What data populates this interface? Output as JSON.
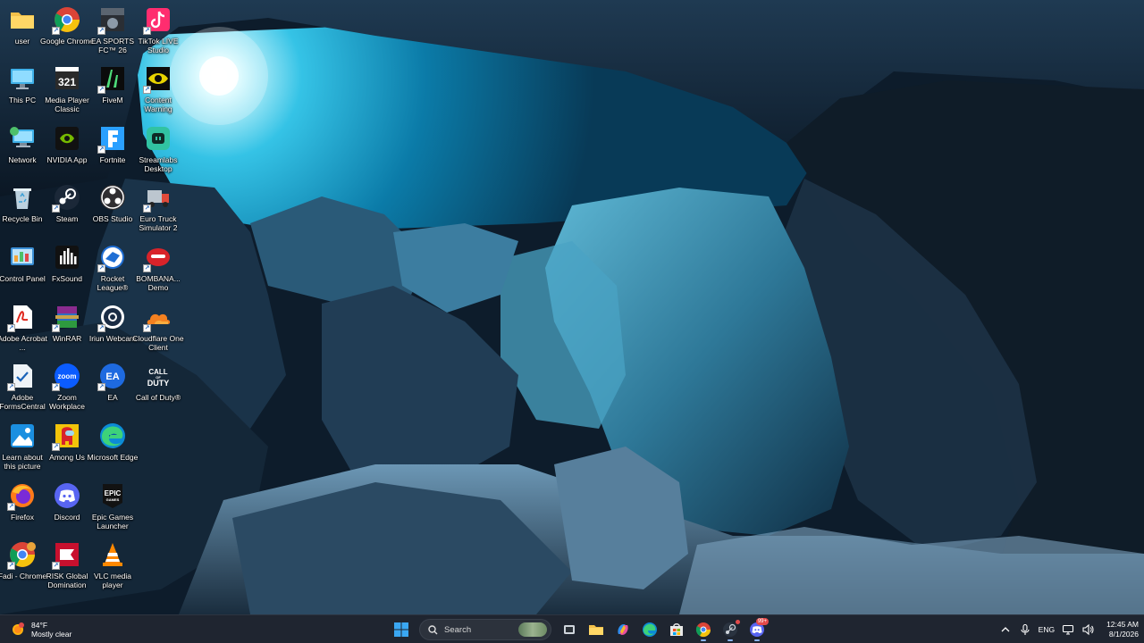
{
  "desktop": {
    "icons": [
      {
        "label": "user",
        "icon": "folder-icon"
      },
      {
        "label": "Google Chrome",
        "icon": "chrome-icon"
      },
      {
        "label": "EA SPORTS FC™ 26",
        "icon": "ea-fc-icon"
      },
      {
        "label": "TikTok LIVE Studio",
        "icon": "tiktok-icon"
      },
      {
        "label": "This PC",
        "icon": "monitor-icon"
      },
      {
        "label": "Media Player Classic",
        "icon": "media-player-icon"
      },
      {
        "label": "FiveM",
        "icon": "fivem-icon"
      },
      {
        "label": "Content Warning",
        "icon": "content-warning-icon"
      },
      {
        "label": "Network",
        "icon": "network-icon"
      },
      {
        "label": "NVIDIA App",
        "icon": "nvidia-icon"
      },
      {
        "label": "Fortnite",
        "icon": "fortnite-icon"
      },
      {
        "label": "Streamlabs Desktop",
        "icon": "streamlabs-icon"
      },
      {
        "label": "Recycle Bin",
        "icon": "recycle-bin-icon"
      },
      {
        "label": "Steam",
        "icon": "steam-icon"
      },
      {
        "label": "OBS Studio",
        "icon": "obs-icon"
      },
      {
        "label": "Euro Truck Simulator 2",
        "icon": "truck-icon"
      },
      {
        "label": "Control Panel",
        "icon": "control-panel-icon"
      },
      {
        "label": "FxSound",
        "icon": "fxsound-icon"
      },
      {
        "label": "Rocket League®",
        "icon": "rocket-league-icon"
      },
      {
        "label": "BOMBANA... Demo",
        "icon": "bombana-icon"
      },
      {
        "label": "Adobe Acrobat ...",
        "icon": "acrobat-icon"
      },
      {
        "label": "WinRAR",
        "icon": "winrar-icon"
      },
      {
        "label": "Iriun Webcam",
        "icon": "webcam-icon"
      },
      {
        "label": "Cloudflare One Client",
        "icon": "cloudflare-icon"
      },
      {
        "label": "Adobe FormsCentral",
        "icon": "formscentral-icon"
      },
      {
        "label": "Zoom Workplace",
        "icon": "zoom-icon"
      },
      {
        "label": "EA",
        "icon": "ea-icon"
      },
      {
        "label": "Call of Duty®",
        "icon": "call-of-duty-icon"
      },
      {
        "label": "Learn about this picture",
        "icon": "learn-picture-icon"
      },
      {
        "label": "Among Us",
        "icon": "among-us-icon"
      },
      {
        "label": "Microsoft Edge",
        "icon": "edge-icon"
      },
      {
        "label": "Firefox",
        "icon": "firefox-icon"
      },
      {
        "label": "Discord",
        "icon": "discord-icon"
      },
      {
        "label": "Epic Games Launcher",
        "icon": "epic-games-icon"
      },
      {
        "label": "Fadi - Chrome",
        "icon": "chrome-profile-icon"
      },
      {
        "label": "RISK Global Domination",
        "icon": "risk-icon"
      },
      {
        "label": "VLC media player",
        "icon": "vlc-icon"
      }
    ]
  },
  "taskbar": {
    "weather": {
      "temp": "84°F",
      "condition": "Mostly clear"
    },
    "search": {
      "placeholder": "Search"
    },
    "pinned": [
      {
        "name": "task-view-icon"
      },
      {
        "name": "file-explorer-icon"
      },
      {
        "name": "copilot-icon"
      },
      {
        "name": "edge-icon"
      },
      {
        "name": "microsoft-store-icon"
      },
      {
        "name": "chrome-icon"
      },
      {
        "name": "steam-icon"
      },
      {
        "name": "discord-icon"
      }
    ],
    "discord_badge": "99+",
    "tray": {
      "language": "ENG",
      "time": "12:45 AM",
      "date": "8/1/2026"
    }
  }
}
